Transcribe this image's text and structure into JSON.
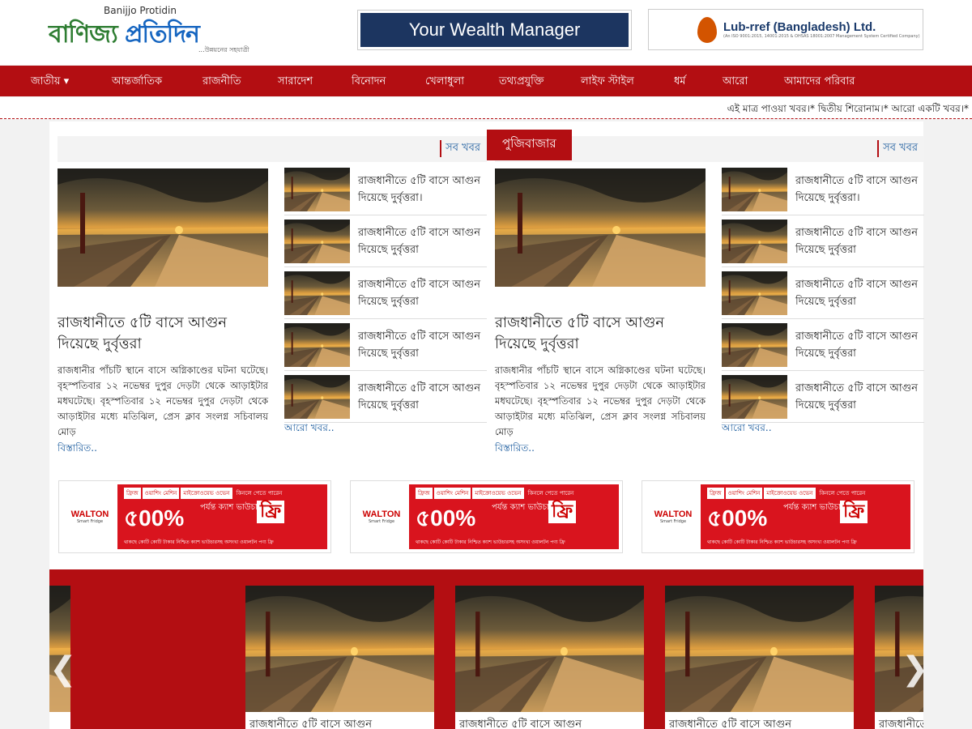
{
  "header": {
    "logo_en": "Banijjo Protidin",
    "logo_bn_1": "বাণিজ্য",
    "logo_bn_2": "প্রতিদিন",
    "logo_tagline": "...উন্নয়নের সহযাত্রী",
    "ad_wealth": "Your Wealth Manager",
    "ad_lubref": "Lub-rref (Bangladesh) Ltd.",
    "ad_lubref_sub": "(An ISO 9001:2015, 14001:2015 & OHSAS 18001:2007 Management System Certified Company)"
  },
  "nav": {
    "items": [
      "জাতীয় ▾",
      "আন্তর্জাতিক",
      "রাজনীতি",
      "সারাদেশ",
      "বিনোদন",
      "খেলাধুলা",
      "তথ্যপ্রযুক্তি",
      "লাইফ স্টাইল",
      "ধর্ম",
      "আরো",
      "আমাদের পরিবার"
    ]
  },
  "ticker": "এই মাত্র পাওয়া খবর।* দ্বিতীয় শিরোনাম।* আরো একটি খবর।*",
  "sections": [
    {
      "title": "",
      "more": "সব খবর",
      "lead_title": "রাজধানীতে ৫টি বাসে আগুন দিয়েছে দুর্বৃত্তরা",
      "lead_text": "রাজধানীর পাঁচটি স্থানে বাসে অগ্নিকাণ্ডের ঘটনা ঘটেছে। বৃহস্পতিবার ১২ নভেম্বর দুপুর দেড়টা থেকে আড়াইটার মধঘটেছে। বৃহস্পতিবার ১২ নভেম্বর দুপুর দেড়টা থেকে আড়াইটার মধ্যে মতিঝিল, প্রেস ক্লাব সংলগ্ন সচিবালয় মোড়",
      "read_more": "বিস্তারিত..",
      "items": [
        "রাজধানীতে ৫টি বাসে আগুন দিয়েছে দুর্বৃত্তরা।",
        "রাজধানীতে ৫টি বাসে আগুন দিয়েছে দুর্বৃত্তরা",
        "রাজধানীতে ৫টি বাসে আগুন দিয়েছে দুর্বৃত্তরা",
        "রাজধানীতে ৫টি বাসে আগুন দিয়েছে দুর্বৃত্তরা",
        "রাজধানীতে ৫টি বাসে আগুন দিয়েছে দুর্বৃত্তরা"
      ],
      "more_news": "আরো খবর.."
    },
    {
      "title": "পুজিবাজার",
      "more": "সব খবর",
      "lead_title": "রাজধানীতে ৫টি বাসে আগুন দিয়েছে দুর্বৃত্তরা",
      "lead_text": "রাজধানীর পাঁচটি স্থানে বাসে অগ্নিকাণ্ডের ঘটনা ঘটেছে। বৃহস্পতিবার ১২ নভেম্বর দুপুর দেড়টা থেকে আড়াইটার মধঘটেছে। বৃহস্পতিবার ১২ নভেম্বর দুপুর দেড়টা থেকে আড়াইটার মধ্যে মতিঝিল, প্রেস ক্লাব সংলগ্ন সচিবালয় মোড়",
      "read_more": "বিস্তারিত..",
      "items": [
        "রাজধানীতে ৫টি বাসে আগুন দিয়েছে দুর্বৃত্তরা।",
        "রাজধানীতে ৫টি বাসে আগুন দিয়েছে দুর্বৃত্তরা",
        "রাজধানীতে ৫টি বাসে আগুন দিয়েছে দুর্বৃত্তরা",
        "রাজধানীতে ৫টি বাসে আগুন দিয়েছে দুর্বৃত্তরা",
        "রাজধানীতে ৫টি বাসে আগুন দিয়েছে দুর্বৃত্তরা"
      ],
      "more_news": "আরো খবর.."
    }
  ],
  "banner": {
    "brand": "WALTON",
    "brand_sub": "Smart Fridge",
    "tags": [
      "ফ্রিজ",
      "ওয়াশিং মেশিন",
      "মাইক্রোওয়েভ ওভেন",
      "কিনলে পেতে পারেন"
    ],
    "percent": "৫00%",
    "promo": "পর্যন্ত ক্যাশ ভাউচার",
    "free": "ফ্রি",
    "footer": "থাকছে কোটি কোটি টাকার নিশ্চিত ক্যাশ ভাউচারসহ অসংখ্য ওয়ালটন পণ্য ফ্রি"
  },
  "slider": {
    "captions": [
      "রাজধানীতে ৫টি বাসে আগুন",
      "রাজধানীতে ৫টি বাসে আগুন",
      "রাজধানীতে ৫টি বাসে আগুন",
      "রাজধানীতে ৫টি বাসে আগুন",
      "রাজধানীতে ৫টি বাসে আগুন"
    ],
    "prev": "❮",
    "next": "❯"
  },
  "colors": {
    "brand_red": "#b30e12",
    "link_blue": "#1c5c9e"
  }
}
